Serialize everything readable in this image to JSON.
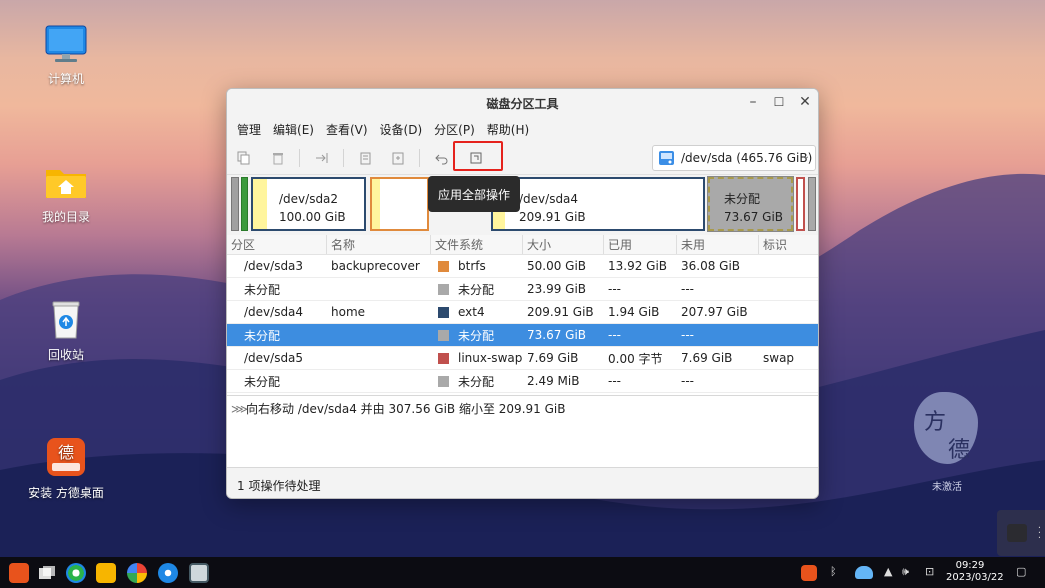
{
  "desktop": {
    "icons": [
      {
        "label": "计算机"
      },
      {
        "label": "我的目录"
      },
      {
        "label": "回收站"
      },
      {
        "label": "安装 方德桌面"
      }
    ],
    "watermark": {
      "line1": "方",
      "line2": "德",
      "caption": "未激活"
    }
  },
  "window": {
    "title": "磁盘分区工具",
    "menu": [
      "管理",
      "编辑(E)",
      "查看(V)",
      "设备(D)",
      "分区(P)",
      "帮助(H)"
    ],
    "device": "/dev/sda (465.76 GiB)",
    "tooltip": "应用全部操作",
    "partition_map": {
      "sda2": {
        "name": "/dev/sda2",
        "size": "100.00 GiB"
      },
      "sda4": {
        "name": "/dev/sda4",
        "size": "209.91 GiB"
      },
      "unalloc": {
        "name": "未分配",
        "size": "73.67 GiB"
      }
    },
    "table": {
      "headers": [
        "分区",
        "名称",
        "文件系统",
        "大小",
        "已用",
        "未用",
        "标识"
      ],
      "rows": [
        {
          "partition": "/dev/sda3",
          "name": "backuprecover",
          "fs": "btrfs",
          "size": "50.00 GiB",
          "used": "13.92 GiB",
          "unused": "36.08 GiB",
          "flags": "",
          "color": "#e08a3c"
        },
        {
          "partition": "未分配",
          "name": "",
          "fs": "未分配",
          "size": "23.99 GiB",
          "used": "---",
          "unused": "---",
          "flags": "",
          "color": "#a9a9a9"
        },
        {
          "partition": "/dev/sda4",
          "name": "home",
          "fs": "ext4",
          "size": "209.91 GiB",
          "used": "1.94 GiB",
          "unused": "207.97 GiB",
          "flags": "",
          "color": "#2c4a6e"
        },
        {
          "partition": "未分配",
          "name": "",
          "fs": "未分配",
          "size": "73.67 GiB",
          "used": "---",
          "unused": "---",
          "flags": "",
          "color": "#a9a9a9"
        },
        {
          "partition": "/dev/sda5",
          "name": "",
          "fs": "linux-swap",
          "size": "7.69 GiB",
          "used": "0.00 字节",
          "unused": "7.69 GiB",
          "flags": "swap",
          "color": "#c0504d"
        },
        {
          "partition": "未分配",
          "name": "",
          "fs": "未分配",
          "size": "2.49 MiB",
          "used": "---",
          "unused": "---",
          "flags": "",
          "color": "#a9a9a9"
        }
      ]
    },
    "pending_operation": "向右移动 /dev/sda4 并由 307.56 GiB 缩小至 209.91 GiB",
    "status": "1 项操作待处理"
  },
  "taskbar": {
    "clock_time": "09:29",
    "clock_date": "2023/03/22"
  }
}
